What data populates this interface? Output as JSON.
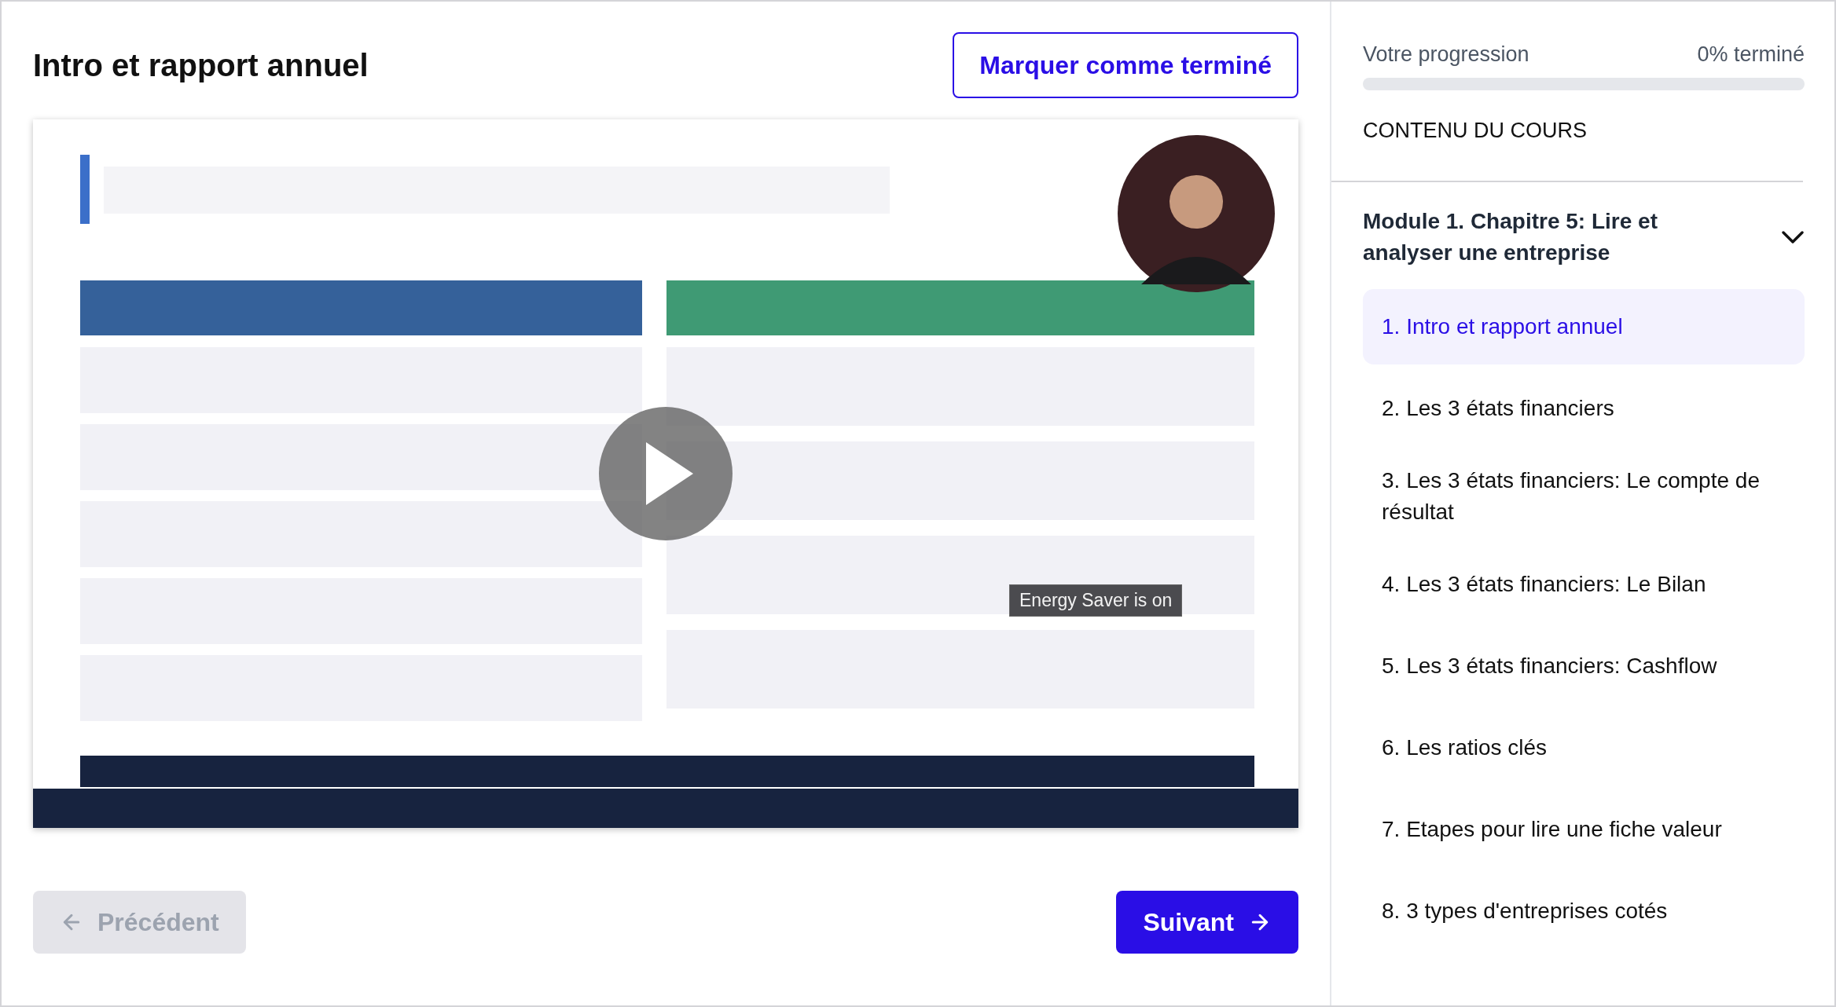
{
  "lesson": {
    "title": "Intro et rapport annuel",
    "complete_button": "Marquer comme terminé"
  },
  "video": {
    "kind": "picture",
    "tooltip": "Energy Saver is on"
  },
  "nav": {
    "previous": {
      "label": "Précédent",
      "disabled": true
    },
    "next": {
      "label": "Suivant",
      "disabled": false
    }
  },
  "sidebar": {
    "progress_label": "Votre progression",
    "progress_reading": "0% terminé",
    "level": 0,
    "section_title": "CONTENU DU COURS",
    "module": {
      "title": "Module 1. Chapitre 5: Lire et analyser une entreprise",
      "expanded": true,
      "lessons": [
        {
          "label": "1. Intro et rapport annuel",
          "selected": true
        },
        {
          "label": "2. Les 3 états financiers",
          "selected": false
        },
        {
          "label": "3. Les 3 états financiers: Le compte de résultat",
          "selected": false
        },
        {
          "label": "4. Les 3 états financiers: Le Bilan",
          "selected": false
        },
        {
          "label": "5. Les 3 états financiers: Cashflow",
          "selected": false
        },
        {
          "label": "6. Les ratios clés",
          "selected": false
        },
        {
          "label": "7. Etapes pour lire une fiche valeur",
          "selected": false
        },
        {
          "label": "8. 3 types d'entreprises cotés",
          "selected": false
        }
      ]
    }
  }
}
